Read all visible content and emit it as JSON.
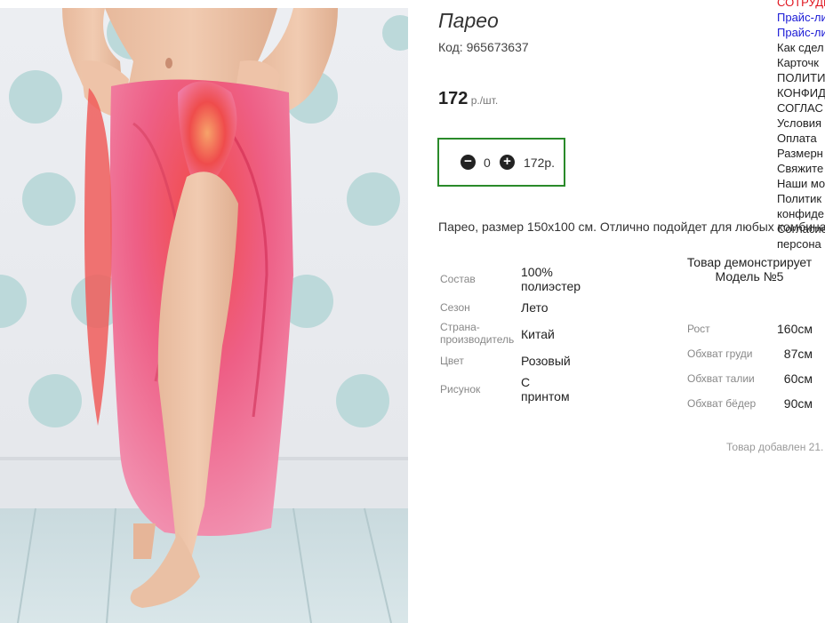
{
  "product": {
    "title": "Парео",
    "code": "Код: 965673637",
    "price_value": "172",
    "price_unit": " р./шт.",
    "description": "Парео, размер 150х100 см. Отлично подойдет для любых комбина",
    "added": "Товар добавлен 21."
  },
  "cart": {
    "minus_icon": "−",
    "plus_icon": "+",
    "quantity": "0",
    "sum": "172р."
  },
  "specs": [
    {
      "label": "Состав",
      "value": "100% полиэстер"
    },
    {
      "label": "Сезон",
      "value": "Лето"
    },
    {
      "label": "Страна-производитель",
      "value": "Китай"
    },
    {
      "label": "Цвет",
      "value": "Розовый"
    },
    {
      "label": "Рисунок",
      "value": "С принтом"
    }
  ],
  "model": {
    "title": "Товар демонстрирует Модель №5",
    "rows": [
      {
        "label": "Рост",
        "value": "160см"
      },
      {
        "label": "Обхват груди",
        "value": "87см"
      },
      {
        "label": "Обхват талии",
        "value": "60см"
      },
      {
        "label": "Обхват бёдер",
        "value": "90см"
      }
    ]
  },
  "sidenav": [
    "СОТРУДН",
    "Прайс-ли",
    "Прайс-ли",
    "Как сдел",
    "Карточк",
    "ПОЛИТИ",
    "КОНФИД",
    "СОГЛАС",
    "Условия",
    "Оплата",
    "Размерн",
    "Свяжите",
    "Наши мо",
    "Политик",
    "конфиде",
    "Согласие",
    "персона"
  ],
  "colors": {
    "cart_border": "#2a8a2a",
    "nav_red": "#e0141e",
    "nav_blue": "#1a1ad6"
  }
}
